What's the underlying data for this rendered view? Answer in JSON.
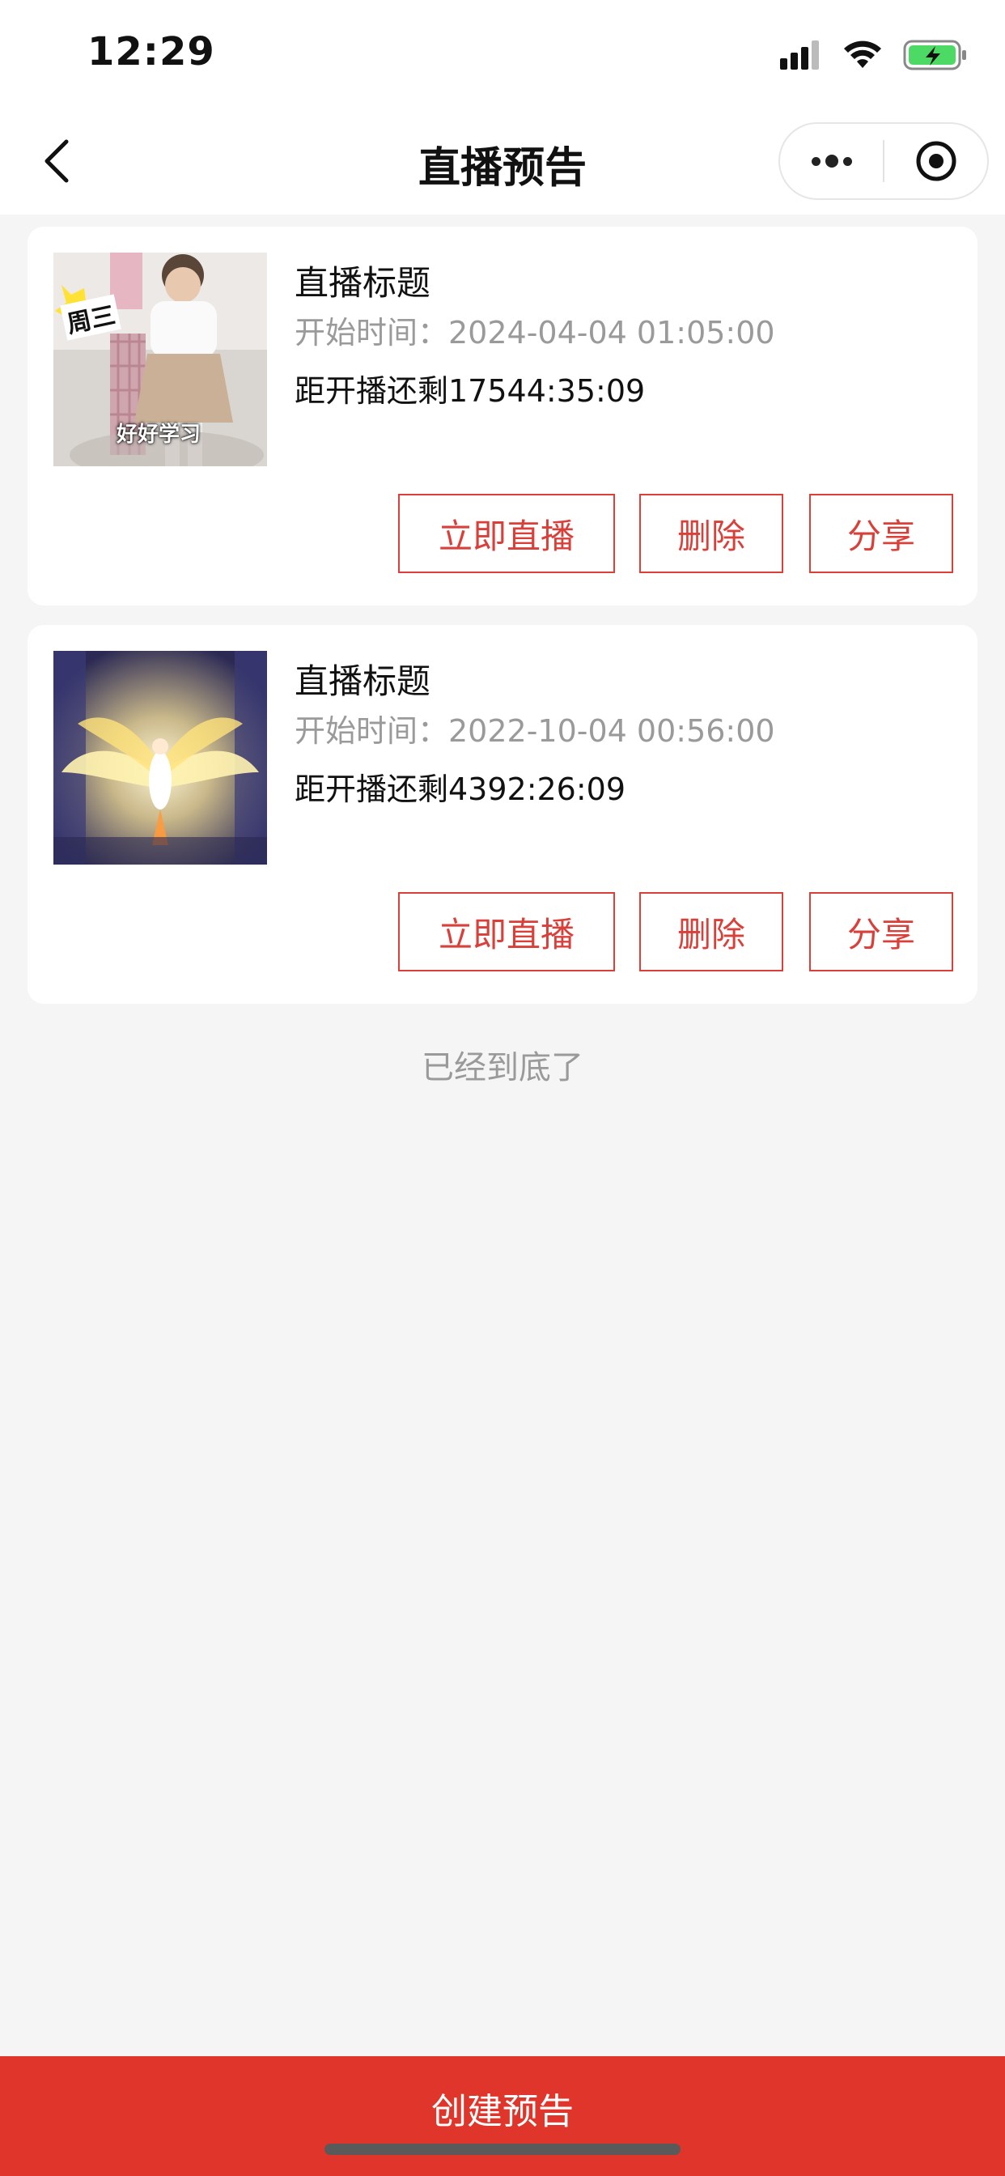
{
  "status_bar": {
    "time": "12:29"
  },
  "nav": {
    "title": "直播预告"
  },
  "cards": [
    {
      "title": "直播标题",
      "start_time": "开始时间：2024-04-04 01:05:00",
      "countdown": "距开播还剩17544:35:09",
      "thumb_caption": "周三",
      "thumb_caption2": "好好学习",
      "buttons": {
        "live": "立即直播",
        "delete": "删除",
        "share": "分享"
      }
    },
    {
      "title": "直播标题",
      "start_time": "开始时间：2022-10-04 00:56:00",
      "countdown": "距开播还剩4392:26:09",
      "buttons": {
        "live": "立即直播",
        "delete": "删除",
        "share": "分享"
      }
    }
  ],
  "list_end_text": "已经到底了",
  "create_button": "创建预告",
  "colors": {
    "accent": "#d9403a",
    "create_bg": "#e0352b",
    "page_bg": "#f5f5f5"
  }
}
